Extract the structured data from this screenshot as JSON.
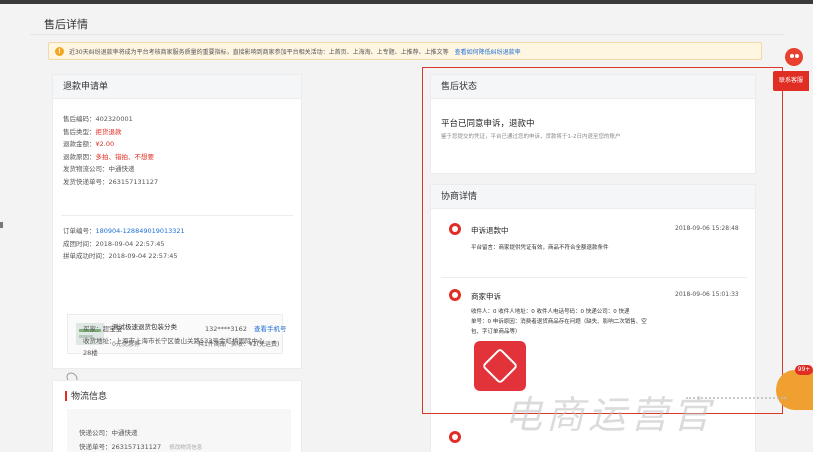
{
  "page": {
    "title": "售后详情"
  },
  "notice": {
    "text": "近30天纠纷退款率将成为平台考核商家服务质量的重要指标，直接影响到商家参加平台相关活动：上首页、上海淘、上专题、上推荐、上推文等",
    "link": "查看如何降低纠纷退款率"
  },
  "refund_form": {
    "title": "退款申请单",
    "fields": [
      {
        "label": "售后编码：",
        "value": "402320001",
        "style": "normal"
      },
      {
        "label": "售后类型：",
        "value": "拒货退款",
        "style": "red"
      },
      {
        "label": "退款金额：",
        "value": "¥2.00",
        "style": "red"
      },
      {
        "label": "退款原因：",
        "value": "多拍、错拍、不想要",
        "style": "red"
      },
      {
        "label": "发货物流公司：",
        "value": "中通快递",
        "style": "normal"
      },
      {
        "label": "发货快递单号：",
        "value": "263157131127",
        "style": "normal"
      }
    ],
    "order": {
      "order_no_label": "订单编号：",
      "order_no": "180904-128849019013321",
      "deal_time_label": "成团时间：",
      "deal_time": "2018-09-04 22:57:45",
      "group_time_label": "拼单成功时间：",
      "group_time": "2018-09-04 22:57:45"
    },
    "product": {
      "name": "测试极速退货包装分类",
      "coupon": "0元优惠券",
      "qty": "共1件商品",
      "paid": "实收：¥2(免运费)"
    },
    "buyer": {
      "label": "买家：",
      "name": "超宝宝",
      "phone": "132****3162",
      "phone_link": "查看手机号",
      "address_label": "收货地址：",
      "address_line1": "上海市上海市长宁区娄山关路533号金虹桥国际中心",
      "address_line2": "28楼"
    }
  },
  "logistics": {
    "title": "物流信息",
    "company_label": "快递公司：",
    "company": "中通快递",
    "tracking_label": "快递单号：",
    "tracking": "263157131127",
    "edit_link": "修改物流信息"
  },
  "status": {
    "title": "售后状态",
    "headline": "平台已同意申诉，退款中",
    "desc": "鉴于您提交的凭证，平台已通过您的申诉，货款将于1-2日内退至您的账户"
  },
  "negotiation": {
    "title": "协商详情",
    "entries": [
      {
        "icon": "record-icon",
        "title": "申诉退款中",
        "time": "2018-09-06 15:28:48",
        "lines": [
          "平台留言：商家提供凭证有效，商品不符合全额退款条件"
        ]
      },
      {
        "icon": "record-icon",
        "title": "商家申诉",
        "time": "2018-09-06 15:01:33",
        "lines": [
          "收件人：0    收件人地址：0    收件人电话号码：0    快递公司：0    快递",
          "单号：0 申诉原因：消费者退货商品存在问题（缺失、影响二次销售、空",
          "包、字订单商品等）"
        ]
      }
    ]
  },
  "side": {
    "service_label": "联系客服",
    "badge": "99+"
  },
  "watermark": "电商运营官",
  "colors": {
    "accent_red": "#e02e24",
    "link_blue": "#1f6fd6",
    "frame_red": "#d9392b",
    "notice_bg": "#fef6e1"
  }
}
